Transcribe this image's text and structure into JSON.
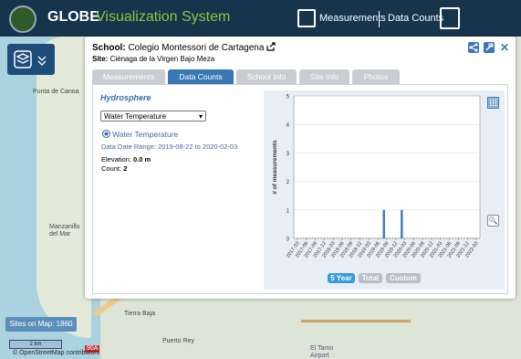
{
  "header": {
    "brand": "GLOBE",
    "title": "Visualization System",
    "measurements_label": "Measurements",
    "data_counts_label": "Data Counts"
  },
  "map": {
    "labels": [
      "Punta de Canoa",
      "Manzanillo del Mar",
      "Tierra Baja",
      "Puerto Rey",
      "El Tamo Airport"
    ],
    "sites_on_map": "Sites on Map: 1860",
    "scale": "2 km",
    "attribution": "© OpenStreetMap contributors",
    "road_shield": "90A"
  },
  "popup": {
    "school_label": "School:",
    "school_name": "Colegio Montessori de Cartagena",
    "site_label": "Site:",
    "site_name": "Ciénaga de la Virgen Bajo Meza",
    "tabs": [
      {
        "label": "Measurements",
        "active": false
      },
      {
        "label": "Data Counts",
        "active": true
      },
      {
        "label": "School Info",
        "active": false
      },
      {
        "label": "Site Info",
        "active": false
      },
      {
        "label": "Photos",
        "active": false
      }
    ],
    "sphere": "Hydrosphere",
    "protocol_select": "Water Temperature",
    "radio_label": "Water Temperature",
    "date_range": "Data Date Range: 2019-08-22 to 2020-02-03",
    "elevation_label": "Elevation:",
    "elevation_value": "0.0 m",
    "count_label": "Count:",
    "count_value": "2",
    "range_buttons": [
      {
        "label": "5 Year",
        "active": true
      },
      {
        "label": "Total",
        "active": false
      },
      {
        "label": "Custom",
        "active": false
      }
    ]
  },
  "colors": {
    "header_bg": "#16344c",
    "accent": "#3a78b5",
    "brand_green": "#8dc63f",
    "bar": "#3a78b5"
  },
  "chart_data": {
    "type": "bar",
    "ylabel": "# of measurements",
    "ylim": [
      0,
      5
    ],
    "yticks": [
      0,
      1,
      2,
      3,
      4,
      5
    ],
    "categories": [
      "2017-03",
      "2017-06",
      "2017-09",
      "2017-12",
      "2018-03",
      "2018-06",
      "2018-09",
      "2018-12",
      "2019-03",
      "2019-06",
      "2019-09",
      "2019-12",
      "2020-03",
      "2020-06",
      "2020-09",
      "2020-12",
      "2021-03",
      "2021-06",
      "2021-09",
      "2021-12",
      "2022-03"
    ],
    "bars": [
      {
        "x": "2019-08",
        "value": 1
      },
      {
        "x": "2020-02",
        "value": 1
      }
    ],
    "grid": true
  }
}
